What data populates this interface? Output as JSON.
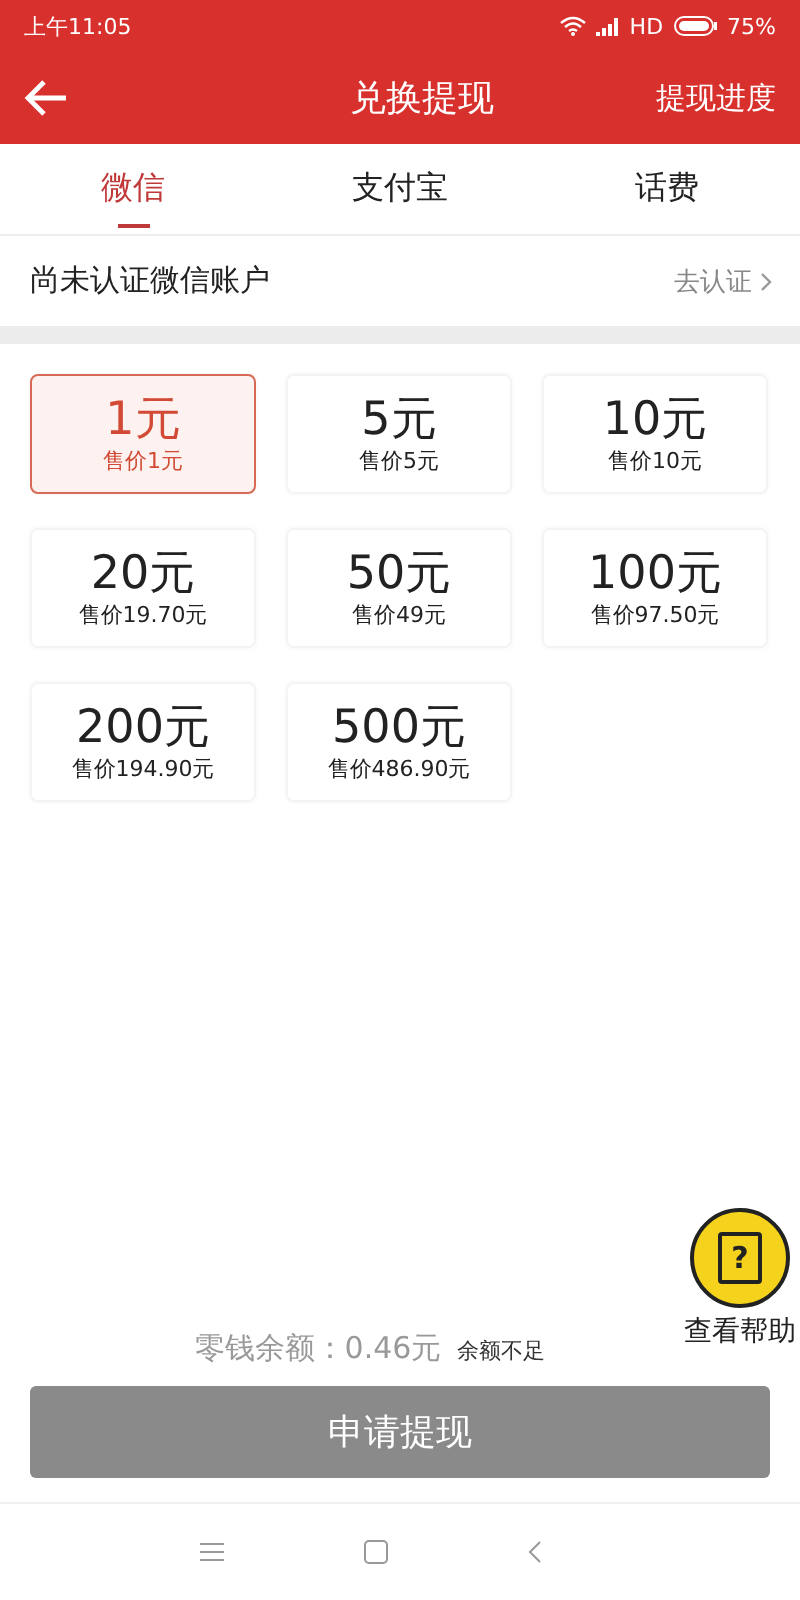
{
  "status_bar": {
    "time": "上午11:05",
    "network": "HD",
    "battery": "75%"
  },
  "header": {
    "title": "兑换提现",
    "action": "提现进度"
  },
  "tabs": [
    {
      "label": "微信",
      "selected": true
    },
    {
      "label": "支付宝",
      "selected": false
    },
    {
      "label": "话费",
      "selected": false
    }
  ],
  "account": {
    "text": "尚未认证微信账户",
    "link": "去认证"
  },
  "denominations": [
    {
      "amount": "1元",
      "price": "售价1元",
      "selected": true
    },
    {
      "amount": "5元",
      "price": "售价5元",
      "selected": false
    },
    {
      "amount": "10元",
      "price": "售价10元",
      "selected": false
    },
    {
      "amount": "20元",
      "price": "售价19.70元",
      "selected": false
    },
    {
      "amount": "50元",
      "price": "售价49元",
      "selected": false
    },
    {
      "amount": "100元",
      "price": "售价97.50元",
      "selected": false
    },
    {
      "amount": "200元",
      "price": "售价194.90元",
      "selected": false
    },
    {
      "amount": "500元",
      "price": "售价486.90元",
      "selected": false
    }
  ],
  "help": {
    "glyph": "?",
    "label": "查看帮助"
  },
  "balance": {
    "text": "零钱余额：0.46元",
    "note": "余额不足"
  },
  "submit": {
    "label": "申请提现",
    "disabled": true
  }
}
